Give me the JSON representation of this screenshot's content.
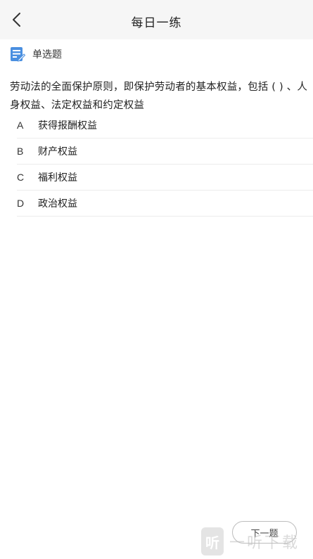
{
  "header": {
    "title": "每日一练",
    "back_icon": "chevron-left-icon"
  },
  "question": {
    "type_icon": "edit-document-icon",
    "type_label": "单选题",
    "text": "劳动法的全面保护原则，即保护劳动者的基本权益，包括 ( ) 、人身权益、法定权益和约定权益",
    "options": [
      {
        "letter": "A",
        "text": "获得报酬权益"
      },
      {
        "letter": "B",
        "text": "财产权益"
      },
      {
        "letter": "C",
        "text": "福利权益"
      },
      {
        "letter": "D",
        "text": "政治权益"
      }
    ]
  },
  "footer": {
    "next_label": "下一题"
  },
  "watermark": {
    "logo_char": "听",
    "text": "一听下载"
  },
  "colors": {
    "header_bg": "#f6f6f6",
    "icon_blue": "#4a8fe0",
    "divider": "#ececec"
  }
}
